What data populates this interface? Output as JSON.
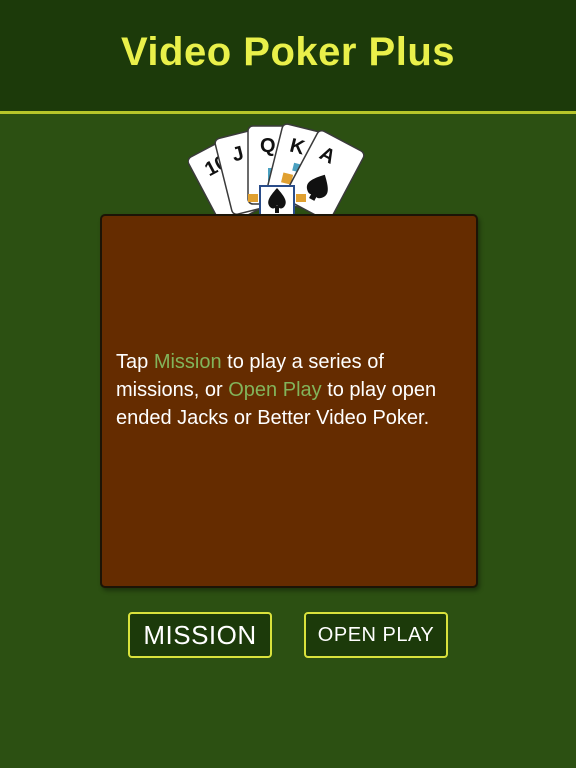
{
  "header": {
    "title": "Video Poker Plus"
  },
  "cards": {
    "icon": "royal-flush-cards",
    "ranks": [
      "10",
      "J",
      "Q",
      "K",
      "A"
    ]
  },
  "panel": {
    "text_1": "Tap ",
    "link_mission": "Mission",
    "text_2": " to play a series of missions, or ",
    "link_open_play": "Open Play",
    "text_3": " to play open ended Jacks or Better Video Poker."
  },
  "buttons": {
    "mission": "MISSION",
    "open_play": "OPEN PLAY"
  },
  "colors": {
    "background": "#2c5012",
    "header": "#1c3a0a",
    "title": "#e9f04a",
    "panel": "#652c00",
    "highlight": "#82b45a",
    "button_border": "#d9e23c"
  }
}
